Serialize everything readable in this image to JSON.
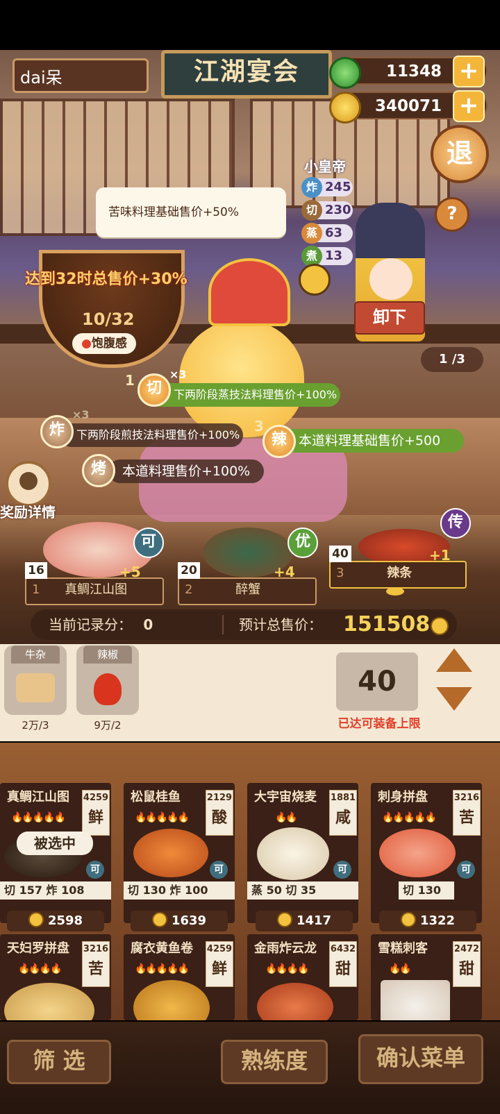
{
  "player": {
    "name": "dai呆"
  },
  "title": "江湖宴会",
  "currency": {
    "jade": "11348",
    "coins": "340071",
    "plus": "+"
  },
  "exit_label": "退",
  "help_label": "?",
  "tooltip": "苦味料理基础售价+50%",
  "bonus": {
    "text": "达到32时总售价+30%",
    "progress": "10/32",
    "satiety": "饱腹感"
  },
  "chef": {
    "name": "小皇帝",
    "stats": [
      {
        "icon": "炸",
        "value": "245",
        "color": "#4a90c8"
      },
      {
        "icon": "切",
        "value": "230",
        "color": "#9a6a3a"
      },
      {
        "icon": "蒸",
        "value": "63",
        "color": "#d88a3a"
      },
      {
        "icon": "煮",
        "value": "13",
        "color": "#5a9a3a"
      }
    ],
    "unload": "卸下",
    "page": "1 /3"
  },
  "skills": [
    {
      "num": "1",
      "badge": "切",
      "mult": "×3",
      "text": "下两阶段蒸技法料理售价+100%"
    },
    {
      "num": "",
      "badge": "炸",
      "mult": "×3",
      "text": "下两阶段煎技法料理售价+100%"
    },
    {
      "num": "3",
      "badge": "辣",
      "mult": "",
      "text": "本道料理基础售价+500"
    },
    {
      "num": "",
      "badge": "烤",
      "mult": "",
      "text": "本道料理售价+100%"
    }
  ],
  "reward_details": "奖励详情",
  "slots": [
    {
      "index": "1",
      "name": "真鲷江山图",
      "count": "16",
      "bonus": "+5",
      "grade": "可",
      "grade_color": "#3f6e7e"
    },
    {
      "index": "2",
      "name": "醉蟹",
      "count": "20",
      "bonus": "+4",
      "grade": "优",
      "grade_color": "#5aa03a"
    },
    {
      "index": "3",
      "name": "辣条",
      "count": "40",
      "bonus": "+1",
      "grade": "传",
      "grade_color": "#6a3a8a"
    }
  ],
  "score": {
    "label": "当前记录分：",
    "value": "0",
    "total_label": "预计总售价：",
    "total": "151508"
  },
  "ingredients": [
    {
      "tag": "牛杂",
      "amount": "2万/3"
    },
    {
      "tag": "辣椒",
      "amount": "9万/2"
    }
  ],
  "equip": {
    "count": "40",
    "note": "已达可装备上限"
  },
  "dishes": [
    {
      "name": "真鲷江山图",
      "flames": "🔥🔥🔥🔥🔥",
      "num": "4259",
      "taste": "鲜",
      "grade": "可",
      "skills": "切 157  炸 108",
      "price": "2598",
      "selected": "被选中"
    },
    {
      "name": "松鼠桂鱼",
      "flames": "🔥🔥🔥🔥🔥",
      "num": "2129",
      "taste": "酸",
      "grade": "可",
      "skills": "切 130  炸 100",
      "price": "1639",
      "selected": ""
    },
    {
      "name": "大宇宙烧麦",
      "flames": "🔥🔥",
      "num": "1881",
      "taste": "咸",
      "grade": "可",
      "skills": "蒸 50  切 35",
      "price": "1417",
      "selected": ""
    },
    {
      "name": "刺身拼盘",
      "flames": "🔥🔥🔥🔥🔥",
      "num": "3216",
      "taste": "苦",
      "grade": "可",
      "skills": "切 130",
      "price": "1322",
      "selected": ""
    },
    {
      "name": "天妇罗拼盘",
      "flames": "🔥🔥🔥🔥",
      "num": "3216",
      "taste": "苦",
      "grade": "",
      "skills": "",
      "price": "",
      "selected": ""
    },
    {
      "name": "腐衣黄鱼卷",
      "flames": "🔥🔥🔥🔥🔥",
      "num": "4259",
      "taste": "鲜",
      "grade": "",
      "skills": "",
      "price": "",
      "selected": ""
    },
    {
      "name": "金雨炸云龙",
      "flames": "🔥🔥🔥🔥",
      "num": "6432",
      "taste": "甜",
      "grade": "",
      "skills": "",
      "price": "",
      "selected": ""
    },
    {
      "name": "雪糕刺客",
      "flames": "🔥🔥",
      "num": "2472",
      "taste": "甜",
      "grade": "",
      "skills": "",
      "price": "",
      "selected": ""
    }
  ],
  "buttons": {
    "filter": "筛  选",
    "proficiency": "熟练度",
    "confirm": "确认菜单"
  },
  "colors": {
    "accent": "#f3b63b",
    "price_orange": "#f7d25a",
    "warning": "#e0402a"
  }
}
